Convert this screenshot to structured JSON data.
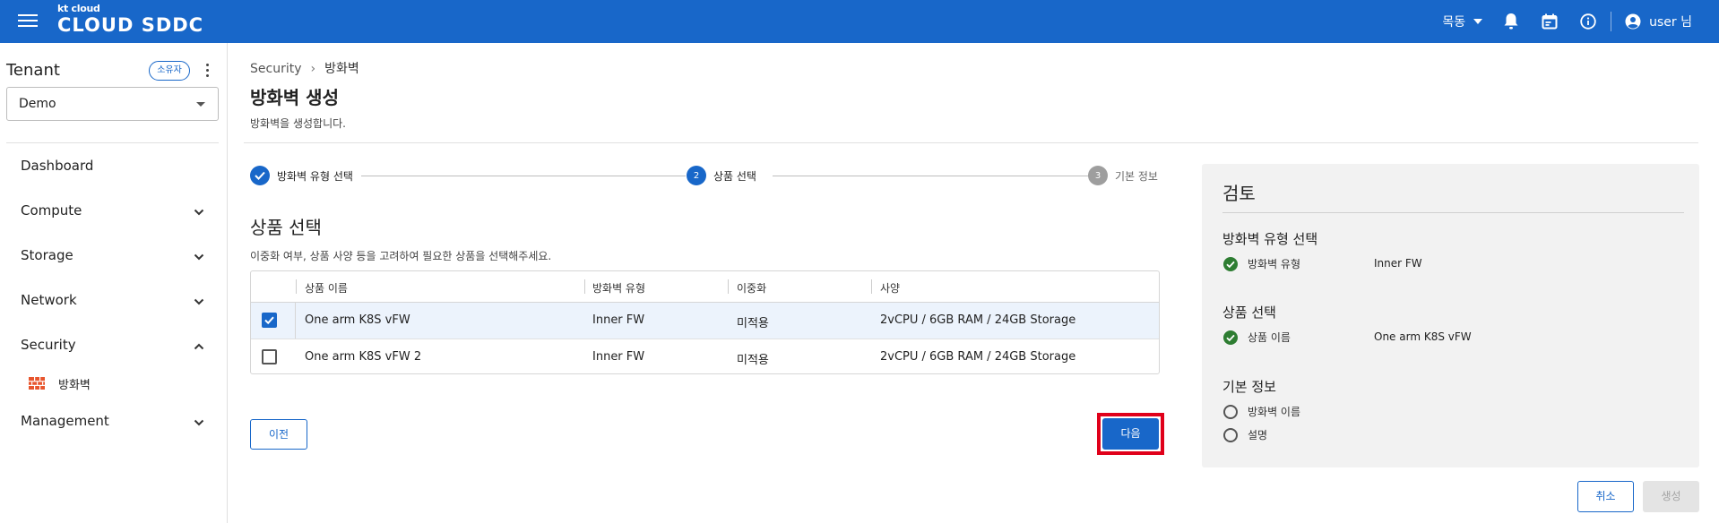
{
  "app": {
    "logo_small": "kt cloud",
    "logo_brand": "CLOUD SDDC",
    "region": "목동",
    "user": "user 님"
  },
  "sidebar": {
    "tenant_title": "Tenant",
    "owner_badge": "소유자",
    "tenant_value": "Demo",
    "items": [
      {
        "label": "Dashboard"
      },
      {
        "label": "Compute"
      },
      {
        "label": "Storage"
      },
      {
        "label": "Network"
      },
      {
        "label": "Security"
      },
      {
        "label": "Management"
      }
    ],
    "sub_item": "방화벽"
  },
  "page": {
    "breadcrumb_root": "Security",
    "breadcrumb_sep": "›",
    "breadcrumb_current": "방화벽",
    "title": "방화벽 생성",
    "subtitle": "방화벽을 생성합니다."
  },
  "stepper": {
    "steps": [
      {
        "number": "✓",
        "label": "방화벽 유형 선택",
        "state": "done"
      },
      {
        "number": "2",
        "label": "상품 선택",
        "state": "active"
      },
      {
        "number": "3",
        "label": "기본 정보",
        "state": "pending"
      }
    ]
  },
  "section": {
    "title": "상품 선택",
    "desc": "이중화 여부, 상품 사양 등을 고려하여 필요한 상품을 선택해주세요."
  },
  "table": {
    "columns": [
      "상품 이름",
      "방화벽 유형",
      "이중화",
      "사양"
    ],
    "rows": [
      {
        "name": "One arm K8S vFW",
        "type": "Inner FW",
        "redundancy": "미적용",
        "spec": "2vCPU / 6GB RAM / 24GB Storage",
        "selected": true
      },
      {
        "name": "One arm K8S vFW 2",
        "type": "Inner FW",
        "redundancy": "미적용",
        "spec": "2vCPU / 6GB RAM / 24GB Storage",
        "selected": false
      }
    ]
  },
  "buttons": {
    "prev": "이전",
    "next": "다음",
    "cancel": "취소",
    "create": "생성"
  },
  "review": {
    "title": "검토",
    "sections": [
      {
        "title": "방화벽 유형 선택",
        "items": [
          {
            "label": "방화벽 유형",
            "value": "Inner FW",
            "done": true
          }
        ]
      },
      {
        "title": "상품 선택",
        "items": [
          {
            "label": "상품 이름",
            "value": "One arm K8S vFW",
            "done": true
          }
        ]
      },
      {
        "title": "기본 정보",
        "items": [
          {
            "label": "방화벽 이름",
            "value": "",
            "done": false
          },
          {
            "label": "설명",
            "value": "",
            "done": false
          }
        ]
      }
    ]
  },
  "colors": {
    "primary": "#1867c9",
    "success": "#2e7d32",
    "highlight": "#e0001a",
    "selected_row": "#ecf3fc"
  }
}
